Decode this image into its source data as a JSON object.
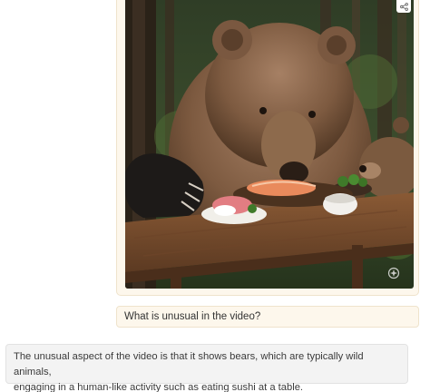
{
  "conversation": {
    "image_message": {
      "share_icon": "share-icon",
      "watermark_icon": "sparkle-watermark-icon"
    },
    "user_message": {
      "text": "What is unusual in the video?"
    },
    "assistant_message": {
      "line1": "The unusual aspect of the video is that it shows bears, which are typically wild animals,",
      "line2": "engaging in a human-like activity such as eating sushi at a table."
    }
  },
  "colors": {
    "user_bubble_bg": "#fdf7ec",
    "user_bubble_border": "#efe3cc",
    "assistant_bubble_bg": "#f3f3f3",
    "text": "#333333"
  }
}
